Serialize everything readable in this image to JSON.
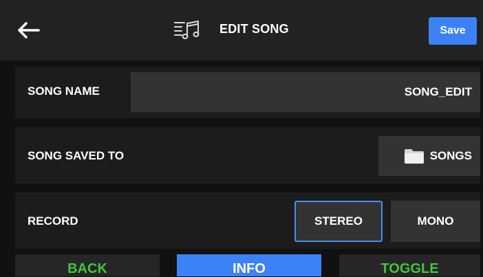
{
  "header": {
    "back_icon": "back-arrow-icon",
    "title_icon": "music-list-icon",
    "title": "EDIT SONG",
    "save_label": "Save"
  },
  "song_name": {
    "label": "SONG NAME",
    "value": "SONG_EDIT"
  },
  "saved_to": {
    "label": "SONG SAVED TO",
    "folder_icon": "folder-icon",
    "folder": "SONGS"
  },
  "record": {
    "label": "RECORD",
    "options": [
      "STEREO",
      "MONO"
    ],
    "selected": "STEREO"
  },
  "footer": {
    "tabs": [
      "BACK",
      "INFO",
      "TOGGLE"
    ],
    "active": "INFO"
  },
  "colors": {
    "accent": "#3b82f6",
    "footer_text": "#3fc73b",
    "background": "#111111"
  }
}
